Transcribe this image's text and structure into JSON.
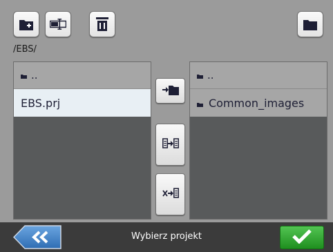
{
  "toolbar": {
    "new_folder_icon": "folder-plus-icon",
    "rename_icon": "rename-icon",
    "delete_icon": "trash-icon",
    "open_folder_icon": "folder-icon"
  },
  "current_path": "/EBS/",
  "left_pane": {
    "parent_label": "..",
    "items": [
      {
        "name": "EBS.prj",
        "selected": true
      }
    ]
  },
  "right_pane": {
    "parent_label": "..",
    "items": [
      {
        "name": "Common_images",
        "type": "folder"
      }
    ]
  },
  "middle_buttons": [
    "move-folder-icon",
    "copy-file-icon",
    "replace-file-icon"
  ],
  "bottom_bar": {
    "status": "Wybierz projekt",
    "back_icon": "double-chevron-left-icon",
    "ok_icon": "checkmark-icon"
  },
  "colors": {
    "background": "#9b9b9b",
    "pane": "#585a5b",
    "pane_header": "#a6a6a6",
    "selected_row": "#e8eff4",
    "icon_navy": "#1e1f35",
    "accent_blue": "#4a86c8",
    "ok_green": "#2fa52f",
    "bottom_bar": "#3b3b3b"
  }
}
